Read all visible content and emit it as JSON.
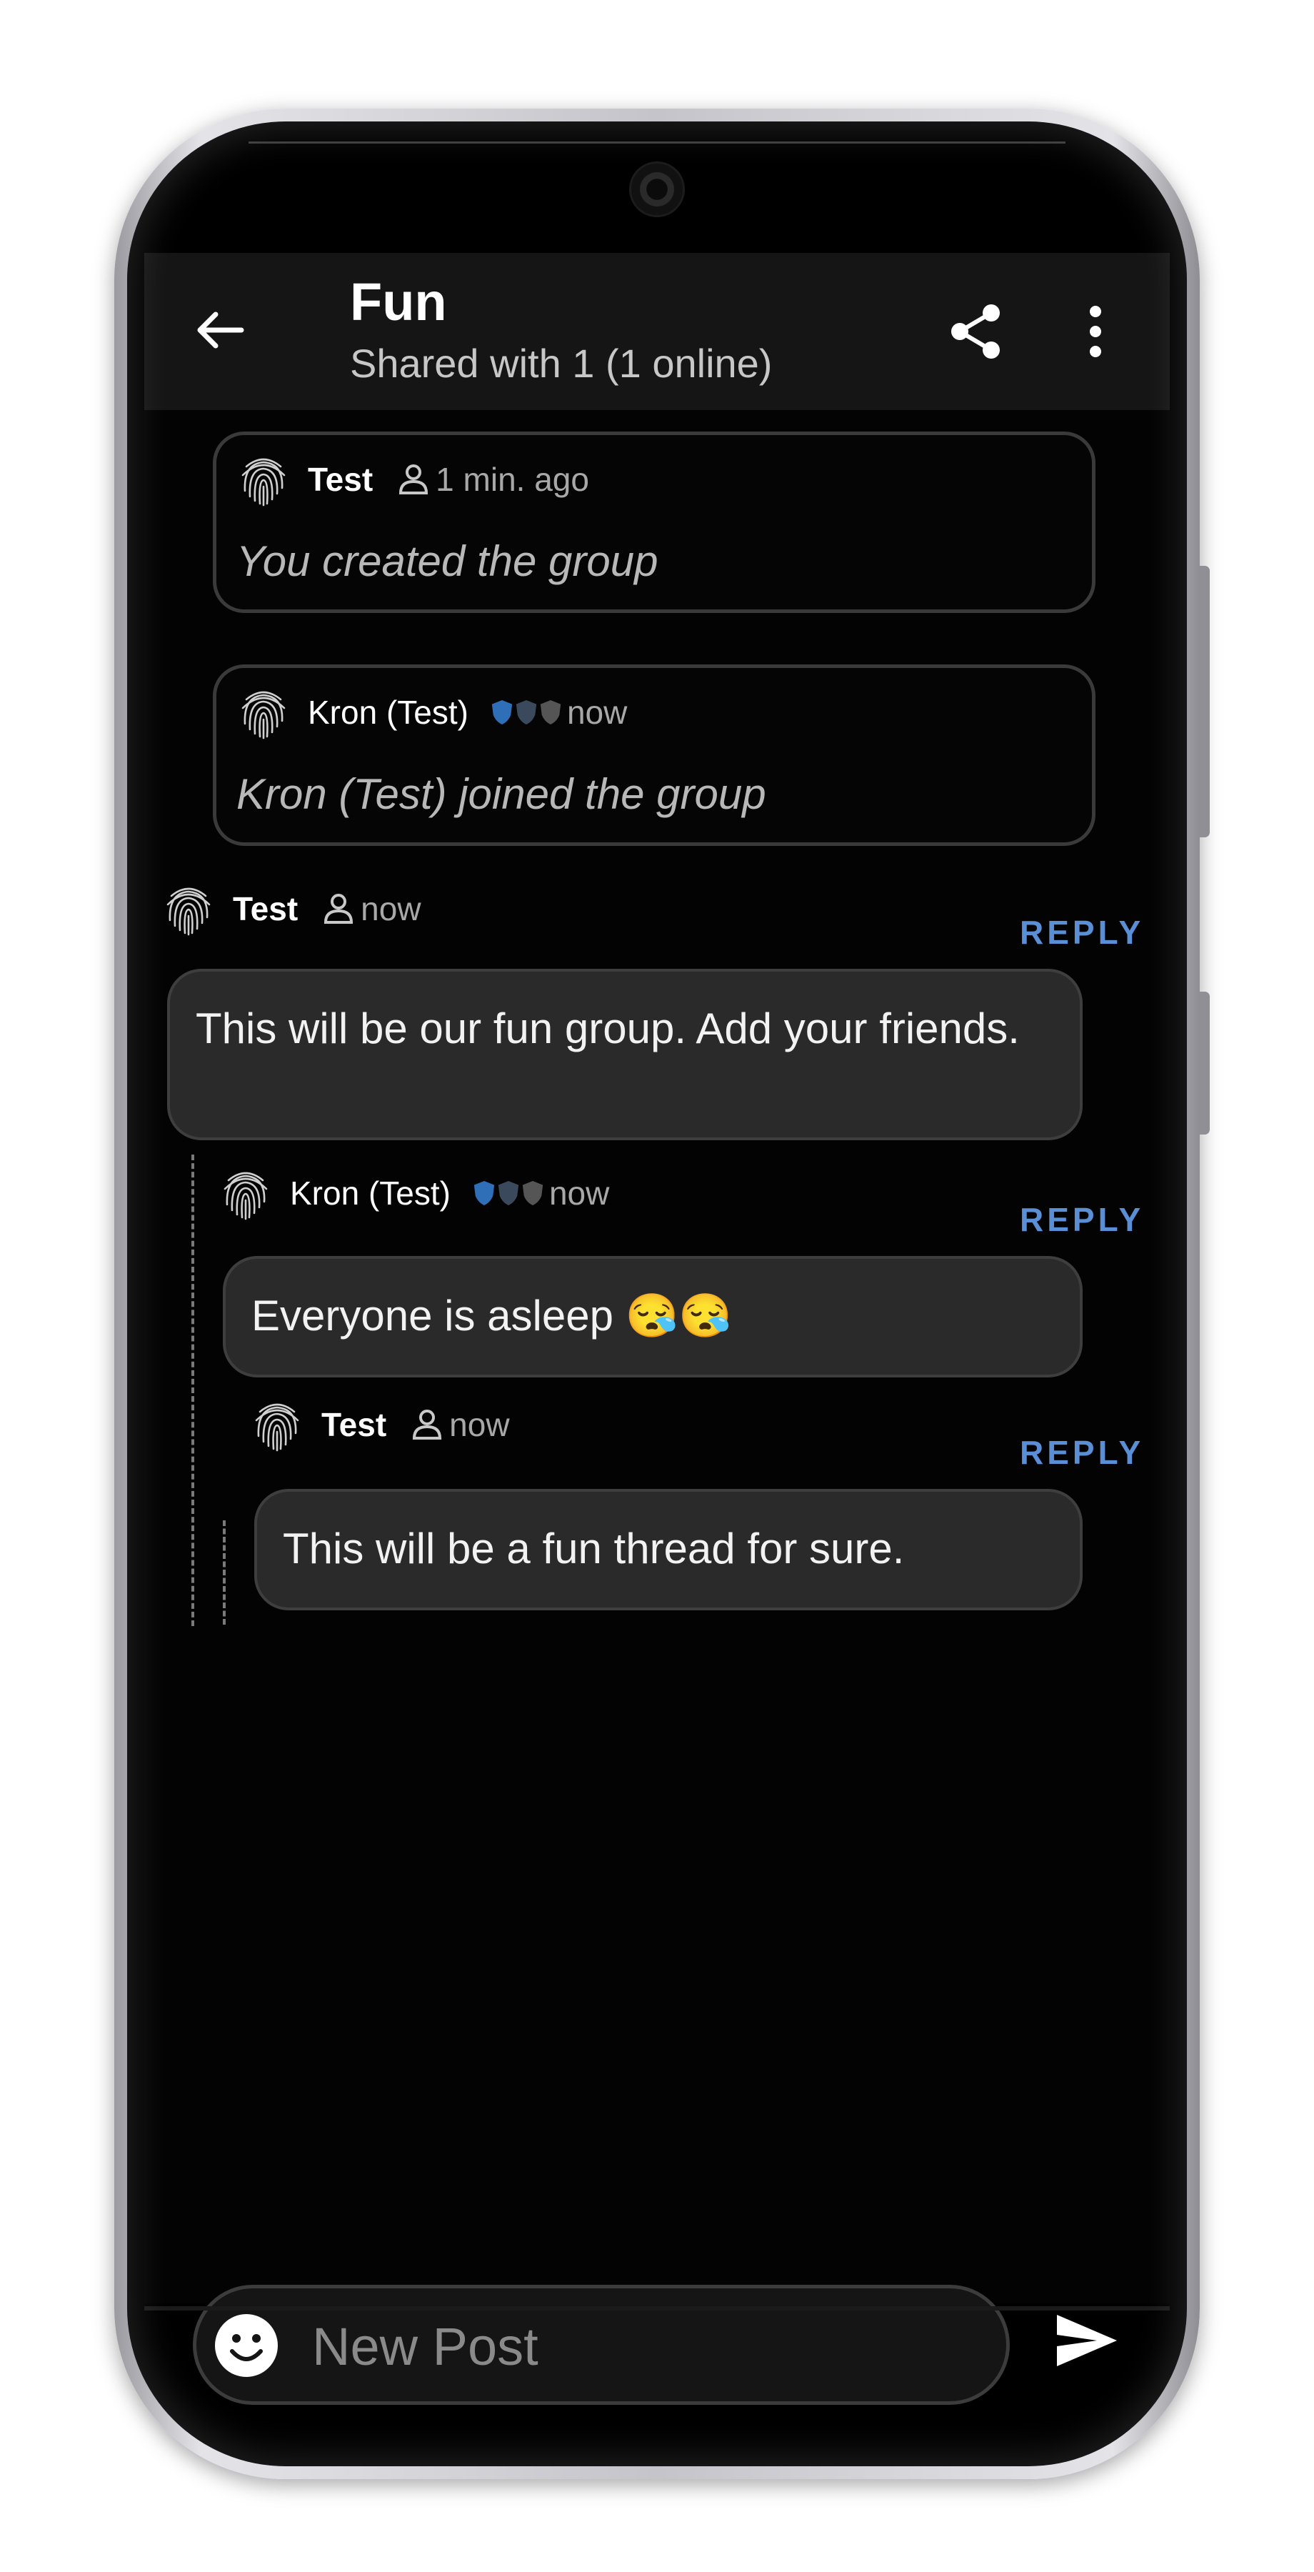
{
  "header": {
    "title": "Fun",
    "subtitle": "Shared with 1 (1 online)",
    "icons": {
      "back": "arrow-left-icon",
      "share": "share-icon",
      "more": "more-vert-icon"
    }
  },
  "events": [
    {
      "author": "Test",
      "author_bold": true,
      "status_icon": "person-icon",
      "time": "1 min. ago",
      "text": "You created the group"
    },
    {
      "author": "Kron (Test)",
      "author_bold": false,
      "status_icon": "shield-icons",
      "time": "now",
      "text": "Kron (Test) joined the group"
    }
  ],
  "posts": [
    {
      "author": "Test",
      "status_icon": "person-icon",
      "time": "now",
      "reply_label": "REPLY",
      "text": "This will be our fun group. Add your friends."
    },
    {
      "author": "Kron (Test)",
      "status_icon": "shield-icons",
      "time": "now",
      "reply_label": "REPLY",
      "text": "Everyone is asleep 😪😪"
    },
    {
      "author": "Test",
      "status_icon": "person-icon",
      "time": "now",
      "reply_label": "REPLY",
      "text": "This will be a fun thread for sure."
    }
  ],
  "composer": {
    "placeholder": "New Post",
    "emoji_icon": "emoji-smile-icon",
    "send_icon": "send-icon"
  },
  "colors": {
    "background": "#030303",
    "header": "#151515",
    "bubble": "#2a2a2a",
    "reply_accent": "#5a8fd6",
    "shield_active": "#2f6fb8"
  }
}
